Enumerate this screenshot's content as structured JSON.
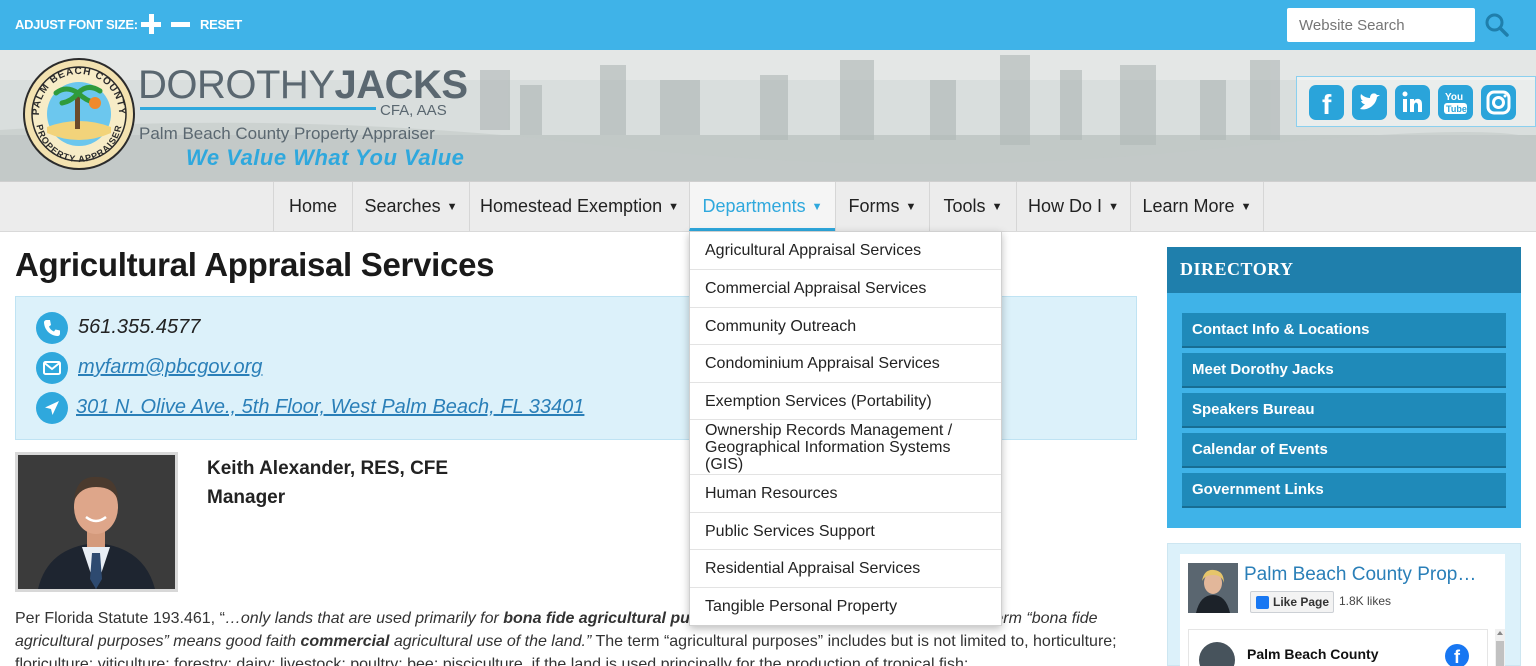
{
  "topbar": {
    "font_size_label": "ADJUST FONT SIZE:",
    "reset_label": "RESET",
    "search_placeholder": "Website Search"
  },
  "header": {
    "brand_first": "DOROTHY",
    "brand_last": "JACKS",
    "credentials": "CFA, AAS",
    "subtitle": "Palm Beach County Property Appraiser",
    "tagline": "We Value What You Value",
    "seal_top_text": "PALM BEACH COUNTY",
    "seal_bottom_text": "PROPERTY APPRAISER",
    "social_icons": [
      "facebook-icon",
      "twitter-icon",
      "linkedin-icon",
      "youtube-icon",
      "instagram-icon"
    ]
  },
  "nav": {
    "items": [
      {
        "label": "Home"
      },
      {
        "label": "Searches"
      },
      {
        "label": "Homestead Exemption"
      },
      {
        "label": "Departments"
      },
      {
        "label": "Forms"
      },
      {
        "label": "Tools"
      },
      {
        "label": "How Do I"
      },
      {
        "label": "Learn More"
      }
    ],
    "active": "Departments"
  },
  "dropdown": {
    "items": [
      "Agricultural Appraisal Services",
      "Commercial Appraisal Services",
      "Community Outreach",
      "Condominium Appraisal Services",
      "Exemption Services (Portability)",
      "Ownership Records Management / Geographical Information Systems (GIS)",
      "Human Resources",
      "Public Services Support",
      "Residential Appraisal Services",
      "Tangible Personal Property"
    ]
  },
  "main": {
    "title": "Agricultural Appraisal Services",
    "phone": "561.355.4577",
    "email": "myfarm@pbcgov.org",
    "address": "301 N. Olive Ave., 5th Floor, West Palm Beach, FL 33401",
    "staff_name": "Keith Alexander, RES, CFE",
    "staff_title": "Manager",
    "body_intro": "Per Florida Statute 193.461, “",
    "body_quote_1": "…only lands that are used primarily for ",
    "body_bold_1": "bona fide agricultural pu",
    "body_hidden_gap": " ",
    "body_tail_1": "term “bona fide",
    "body_line_2a": "agricultural purposes” means good faith ",
    "body_bold_2": "commercial",
    "body_line_2b": " agricultural use of the land.”",
    "body_line_2c": " The term “agricultural purposes” includes but is not limited to,",
    "body_line_3": "horticulture; floriculture; viticulture; forestry; dairy; livestock; poultry; bee; pisciculture, if the land is used principally for the production of tropical fish;"
  },
  "sidebar": {
    "directory_title": "DIRECTORY",
    "links": [
      "Contact Info & Locations",
      "Meet Dorothy Jacks",
      "Speakers Bureau",
      "Calendar of Events",
      "Government Links"
    ],
    "fb": {
      "page_name": "Palm Beach County Prop…",
      "like_label": "Like Page",
      "likes": "1.8K likes",
      "post_author": "Palm Beach County"
    }
  },
  "colors": {
    "accent": "#3fb3e8",
    "dark_accent": "#1f7fac",
    "link": "#2a7fb8",
    "contact_bg": "#dcf1fa"
  }
}
